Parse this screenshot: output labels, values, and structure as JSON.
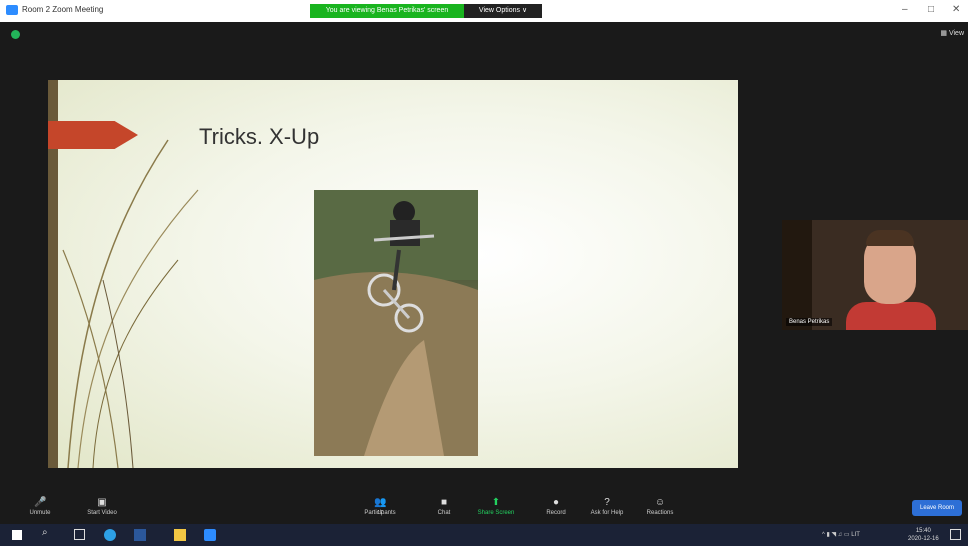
{
  "window": {
    "title": "Room 2 Zoom Meeting",
    "banner": "You are viewing Benas Petrikas' screen",
    "view_options": "View Options ∨",
    "controls": [
      "–",
      "□",
      "✕"
    ]
  },
  "meeting": {
    "view_label": "View",
    "slide_title": "Tricks. X-Up"
  },
  "participant": {
    "name": "Benas Petrikas"
  },
  "toolbar": {
    "unmute": "Unmute",
    "start_video": "Start Video",
    "participants": "Participants",
    "participants_count": "17",
    "chat": "Chat",
    "share_screen": "Share Screen",
    "record": "Record",
    "ask_for_help": "Ask for Help",
    "reactions": "Reactions",
    "leave_room": "Leave Room"
  },
  "taskbar": {
    "lang": "LIT",
    "time": "15:40",
    "date": "2020-12-16"
  },
  "colors": {
    "share_green": "#19b41f",
    "leave_blue": "#2d6fd6",
    "slide_arrow": "#c5462a"
  }
}
